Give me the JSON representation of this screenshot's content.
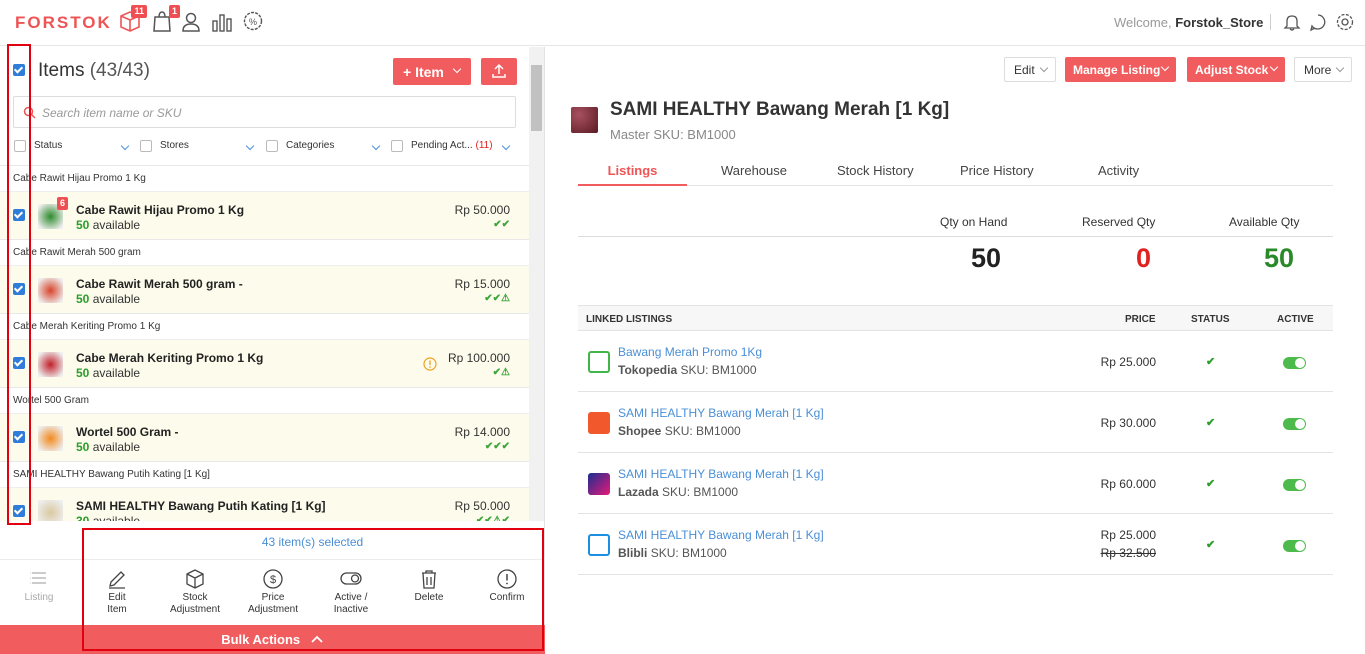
{
  "topbar": {
    "logo": "FORSTOK",
    "icons": [
      {
        "name": "package-icon",
        "badge": "11"
      },
      {
        "name": "shopping-bag-icon",
        "badge": "1"
      },
      {
        "name": "user-icon"
      },
      {
        "name": "bar-chart-icon"
      },
      {
        "name": "discount-icon"
      }
    ],
    "welcome_prefix": "Welcome,",
    "username": "Forstok_Store"
  },
  "items": {
    "title": "Items",
    "count": "(43/43)",
    "add_button": "+ Item",
    "search_placeholder": "Search item name or SKU",
    "filters": {
      "status": "Status",
      "stores": "Stores",
      "categories": "Categories",
      "pending": "Pending Act...",
      "pending_count": "(11)"
    },
    "list": [
      {
        "group": "Cabe Rawit Hijau Promo 1 Kg",
        "name": "Cabe Rawit Hijau Promo 1 Kg",
        "qty": "50",
        "avail": "available",
        "price": "Rp 50.000",
        "status": "✔✔",
        "badge": "6",
        "color": "#2e8b2e"
      },
      {
        "group": "Cabe Rawit Merah 500 gram",
        "name": "Cabe Rawit Merah 500 gram -",
        "qty": "50",
        "avail": "available",
        "price": "Rp 15.000",
        "status": "✔✔⚠",
        "color": "#d8442b"
      },
      {
        "group": "Cabe Merah Keriting Promo 1 Kg",
        "name": "Cabe Merah Keriting Promo 1 Kg",
        "qty": "50",
        "avail": "available",
        "price": "Rp 100.000",
        "status": "✔⚠",
        "color": "#c0202a"
      },
      {
        "group": "Wortel 500 Gram",
        "name": "Wortel 500 Gram -",
        "qty": "50",
        "avail": "available",
        "price": "Rp 14.000",
        "status": "✔✔✔",
        "color": "#f28a1e"
      },
      {
        "group": "SAMI HEALTHY Bawang Putih Kating [1 Kg]",
        "name": "SAMI HEALTHY Bawang Putih Kating [1 Kg]",
        "qty": "30",
        "avail": "available",
        "price": "Rp 50.000",
        "status": "✔✔⚠✔",
        "color": "#d9c9a0"
      }
    ],
    "selected_text": "43 item(s) selected"
  },
  "bottom_actions": {
    "listing": "Listing",
    "edit": [
      "Edit",
      "Item"
    ],
    "stock": [
      "Stock",
      "Adjustment"
    ],
    "price": [
      "Price",
      "Adjustment"
    ],
    "active": [
      "Active /",
      "Inactive"
    ],
    "delete": "Delete",
    "confirm": "Confirm",
    "bulk": "Bulk Actions"
  },
  "product": {
    "edit_button": "Edit",
    "manage_listing": "Manage Listing",
    "adjust_stock": "Adjust Stock",
    "more_button": "More",
    "title": "SAMI HEALTHY Bawang Merah [1 Kg]",
    "master_sku": "Master SKU: BM1000",
    "tabs": [
      "Listings",
      "Warehouse",
      "Stock History",
      "Price History",
      "Activity"
    ],
    "qty_on_hand_label": "Qty on Hand",
    "reserved_label": "Reserved Qty",
    "available_label": "Available Qty",
    "qty_on_hand": "50",
    "reserved": "0",
    "available": "50",
    "colors": {
      "reserved": "#e0211f",
      "available": "#2a8a2a",
      "accent": "#f15c5e"
    },
    "listing_headers": [
      "LINKED LISTINGS",
      "PRICE",
      "STATUS",
      "ACTIVE"
    ],
    "listings": [
      {
        "title": "Bawang Merah Promo 1Kg",
        "store": "Tokopedia",
        "sku": "SKU: BM1000",
        "price": "Rp  25.000",
        "icon": "tokopedia-icon"
      },
      {
        "title": "SAMI HEALTHY Bawang Merah [1 Kg]",
        "store": "Shopee",
        "sku": "SKU: BM1000",
        "price": "Rp  30.000",
        "icon": "shopee-icon"
      },
      {
        "title": "SAMI HEALTHY Bawang Merah [1 Kg]",
        "store": "Lazada",
        "sku": "SKU: BM1000",
        "price": "Rp  60.000",
        "icon": "lazada-icon"
      },
      {
        "title": "SAMI HEALTHY Bawang Merah [1 Kg]",
        "store": "Blibli",
        "sku": "SKU: BM1000",
        "price": "Rp 25.000",
        "old_price": "Rp  32.500",
        "icon": "blibli-icon"
      }
    ]
  }
}
